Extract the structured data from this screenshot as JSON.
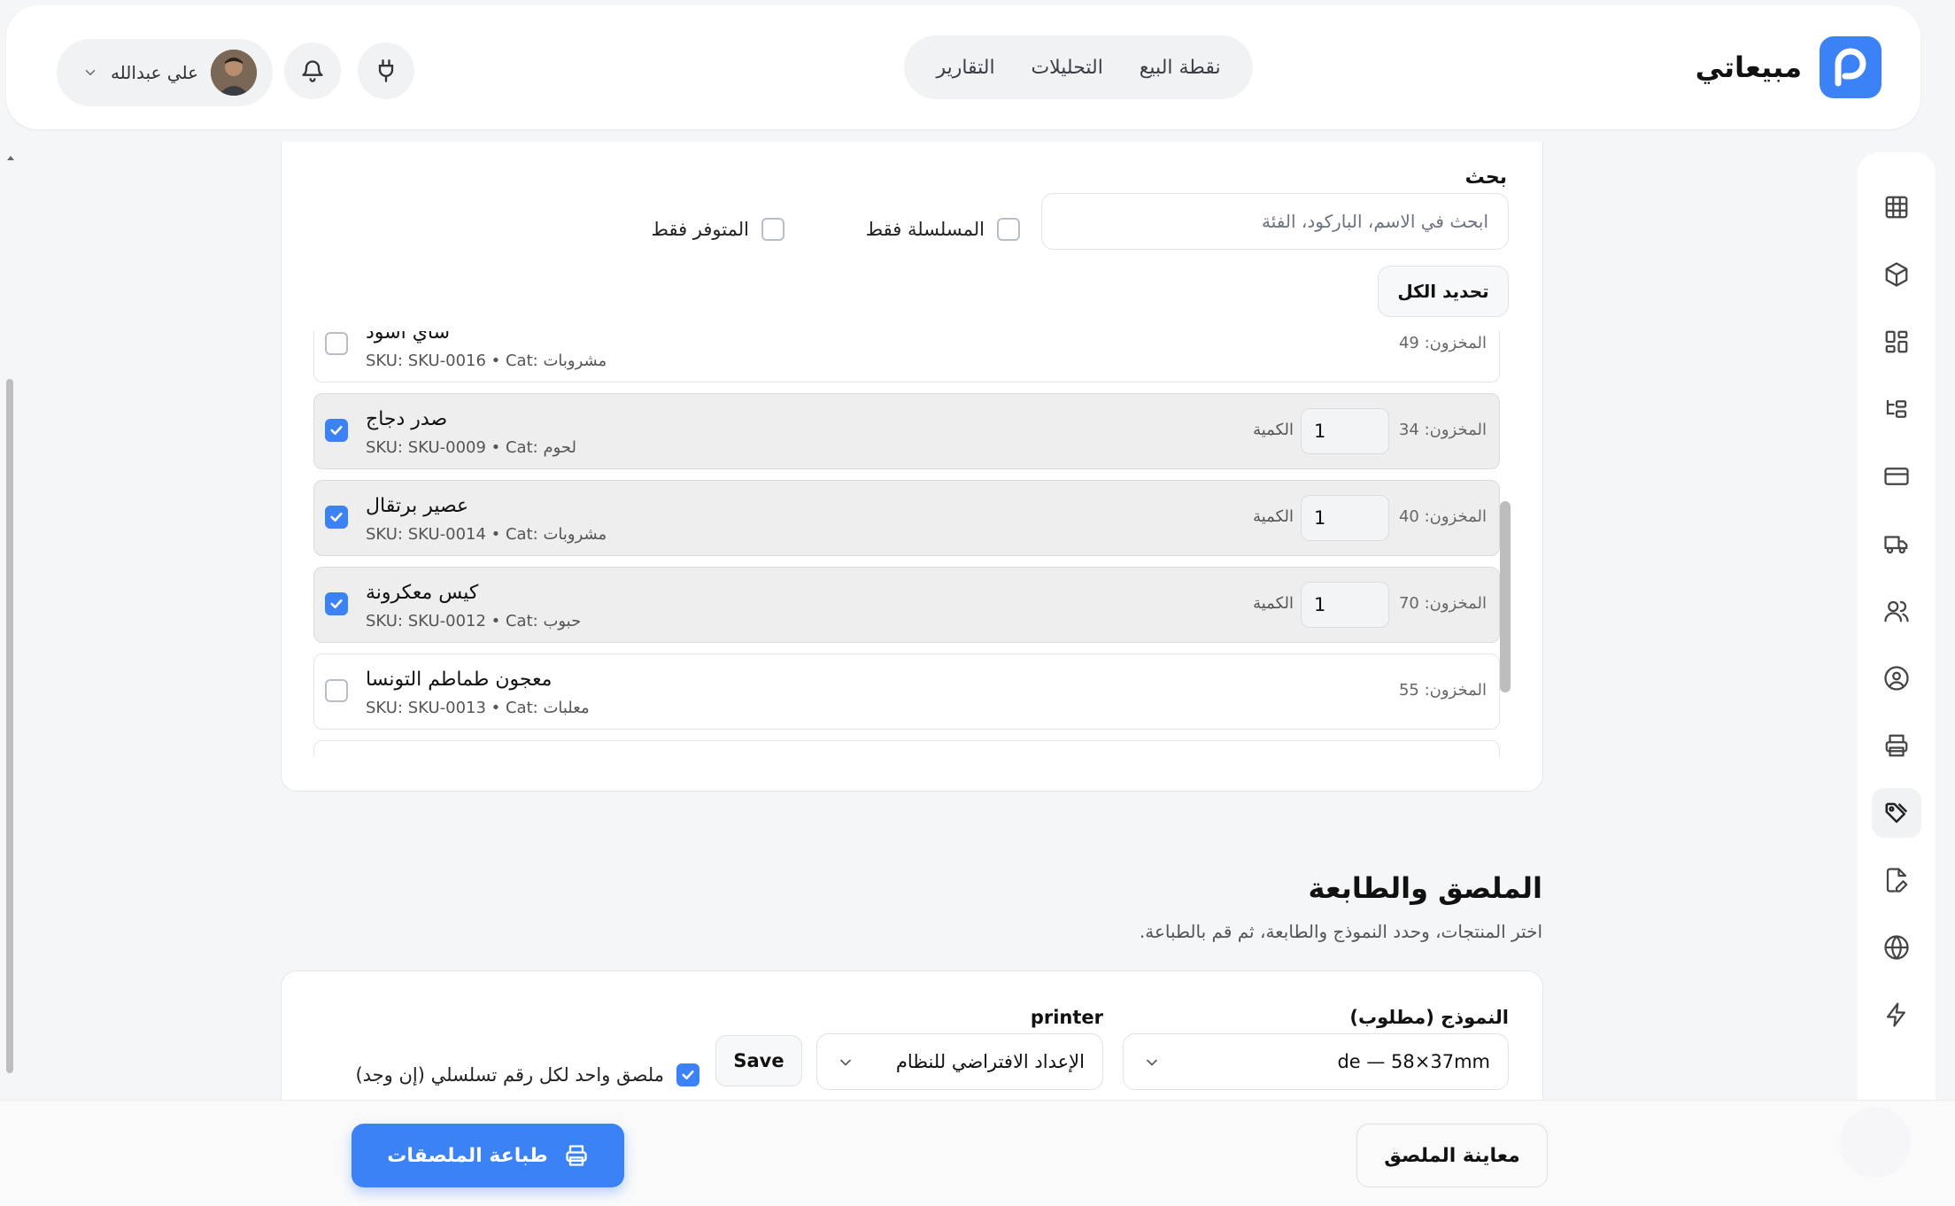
{
  "header": {
    "brand_name": "مبيعاتي",
    "nav": [
      "نقطة البيع",
      "التحليلات",
      "التقارير"
    ],
    "user_name": "علي عبدالله"
  },
  "products": {
    "search_label": "بحث",
    "search_placeholder": "ابحث في الاسم، الباركود، الفئة",
    "filter_serialized": "المسلسلة فقط",
    "filter_in_stock": "المتوفر فقط",
    "select_all": "تحديد الكل",
    "qty_label": "الكمية",
    "items": [
      {
        "name": "شاي أسود",
        "sku": "SKU: SKU-0016 • Cat: مشروبات",
        "stock": "المخزون: 49",
        "selected": false,
        "qty": ""
      },
      {
        "name": "صدر دجاج",
        "sku": "SKU: SKU-0009 • Cat: لحوم",
        "stock": "المخزون: 34",
        "selected": true,
        "qty": "1"
      },
      {
        "name": "عصير برتقال",
        "sku": "SKU: SKU-0014 • Cat: مشروبات",
        "stock": "المخزون: 40",
        "selected": true,
        "qty": "1"
      },
      {
        "name": "كيس معكرونة",
        "sku": "SKU: SKU-0012 • Cat: حبوب",
        "stock": "المخزون: 70",
        "selected": true,
        "qty": "1"
      },
      {
        "name": "معجون طماطم التونسا",
        "sku": "SKU: SKU-0013 • Cat: معلبات",
        "stock": "المخزون: 55",
        "selected": false,
        "qty": ""
      }
    ]
  },
  "label_section": {
    "title": "الملصق والطابعة",
    "subtitle": "اختر المنتجات، وحدد النموذج والطابعة، ثم قم بالطباعة.",
    "template_label": "النموذج (مطلوب)",
    "template_value": "de — 58×37mm",
    "printer_label": "printer",
    "printer_value": "الإعداد الافتراضي للنظام",
    "save_label": "Save",
    "one_per_serial": "ملصق واحد لكل رقم تسلسلي (إن وجد)"
  },
  "actions": {
    "preview": "معاينة الملصق",
    "print": "طباعة الملصقات"
  },
  "colors": {
    "accent": "#3b82f6",
    "row_selected": "#eeeeee"
  },
  "sidebar_icons": [
    "grid-icon",
    "box-icon",
    "apps-icon",
    "tree-icon",
    "card-icon",
    "truck-icon",
    "users-icon",
    "user-circle-icon",
    "printer-icon",
    "tags-icon",
    "file-edit-icon",
    "globe-icon",
    "bolt-icon"
  ]
}
